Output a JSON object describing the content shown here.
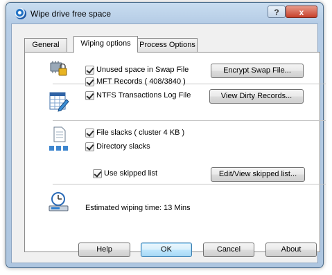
{
  "window": {
    "title": "Wipe drive free space"
  },
  "tabs": [
    {
      "label": "General"
    },
    {
      "label": "Wiping options"
    },
    {
      "label": "Process Options"
    }
  ],
  "swap": {
    "checkbox_label": "Unused space in Swap File",
    "button_label": "Encrypt Swap File..."
  },
  "mft": {
    "records_label": "MFT Records ( 408/3840 )",
    "log_label": "NTFS Transactions Log File",
    "button_label": "View Dirty Records..."
  },
  "slacks": {
    "file_label": "File slacks ( cluster 4 KB )",
    "dir_label": "Directory slacks",
    "skipped_label": "Use skipped list",
    "skipped_button_label": "Edit/View skipped list..."
  },
  "estimate": {
    "text": "Estimated wiping time:  13 Mins"
  },
  "footer": {
    "help": "Help",
    "ok": "OK",
    "cancel": "Cancel",
    "about": "About"
  },
  "titlebar": {
    "help_glyph": "?",
    "close_glyph": "x"
  },
  "icons": {
    "app": "app-disk-icon",
    "swap": "chip-lock-icon",
    "mft": "table-pen-icon",
    "slacks": "document-blocks-icon",
    "timer": "clock-drive-icon"
  },
  "colors": {
    "accent": "#3c7fb1",
    "close": "#c7412b",
    "frame": "#b6cde6"
  }
}
